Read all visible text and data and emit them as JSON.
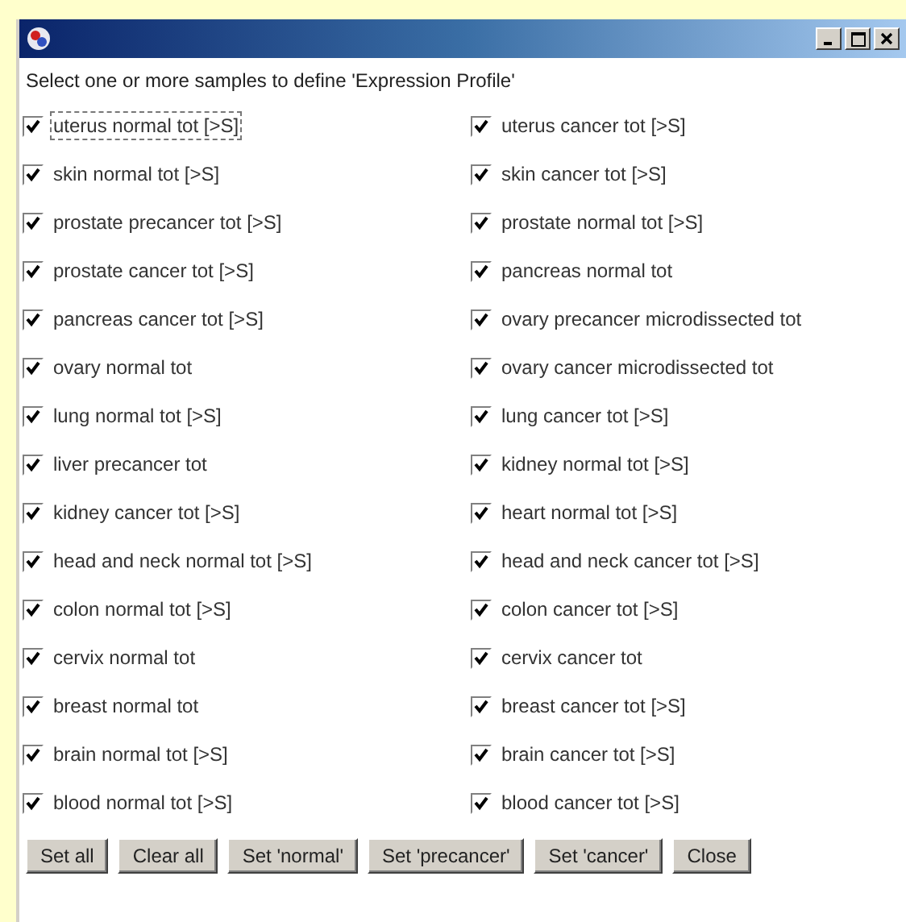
{
  "instruction": "Select one or more samples to define 'Expression Profile'",
  "samples": [
    {
      "label": "uterus normal tot [>S]",
      "checked": true,
      "focused": true
    },
    {
      "label": "uterus cancer tot [>S]",
      "checked": true,
      "focused": false
    },
    {
      "label": "skin normal tot [>S]",
      "checked": true,
      "focused": false
    },
    {
      "label": "skin cancer tot [>S]",
      "checked": true,
      "focused": false
    },
    {
      "label": "prostate precancer tot [>S]",
      "checked": true,
      "focused": false
    },
    {
      "label": "prostate normal tot [>S]",
      "checked": true,
      "focused": false
    },
    {
      "label": "prostate cancer tot [>S]",
      "checked": true,
      "focused": false
    },
    {
      "label": "pancreas normal tot",
      "checked": true,
      "focused": false
    },
    {
      "label": "pancreas cancer tot [>S]",
      "checked": true,
      "focused": false
    },
    {
      "label": "ovary precancer microdissected tot",
      "checked": true,
      "focused": false
    },
    {
      "label": "ovary normal tot",
      "checked": true,
      "focused": false
    },
    {
      "label": "ovary cancer microdissected tot",
      "checked": true,
      "focused": false
    },
    {
      "label": "lung normal tot [>S]",
      "checked": true,
      "focused": false
    },
    {
      "label": "lung cancer tot [>S]",
      "checked": true,
      "focused": false
    },
    {
      "label": "liver precancer tot",
      "checked": true,
      "focused": false
    },
    {
      "label": "kidney normal tot [>S]",
      "checked": true,
      "focused": false
    },
    {
      "label": "kidney cancer tot [>S]",
      "checked": true,
      "focused": false
    },
    {
      "label": "heart normal tot [>S]",
      "checked": true,
      "focused": false
    },
    {
      "label": "head and neck normal tot [>S]",
      "checked": true,
      "focused": false
    },
    {
      "label": "head and neck cancer tot [>S]",
      "checked": true,
      "focused": false
    },
    {
      "label": "colon normal tot [>S]",
      "checked": true,
      "focused": false
    },
    {
      "label": "colon cancer tot [>S]",
      "checked": true,
      "focused": false
    },
    {
      "label": "cervix normal tot",
      "checked": true,
      "focused": false
    },
    {
      "label": "cervix cancer tot",
      "checked": true,
      "focused": false
    },
    {
      "label": "breast normal tot",
      "checked": true,
      "focused": false
    },
    {
      "label": "breast cancer tot [>S]",
      "checked": true,
      "focused": false
    },
    {
      "label": "brain normal tot [>S]",
      "checked": true,
      "focused": false
    },
    {
      "label": "brain cancer tot [>S]",
      "checked": true,
      "focused": false
    },
    {
      "label": "blood normal tot [>S]",
      "checked": true,
      "focused": false
    },
    {
      "label": "blood cancer tot [>S]",
      "checked": true,
      "focused": false
    }
  ],
  "buttons": [
    "Set all",
    "Clear all",
    "Set 'normal'",
    "Set 'precancer'",
    "Set 'cancer'",
    "Close"
  ]
}
